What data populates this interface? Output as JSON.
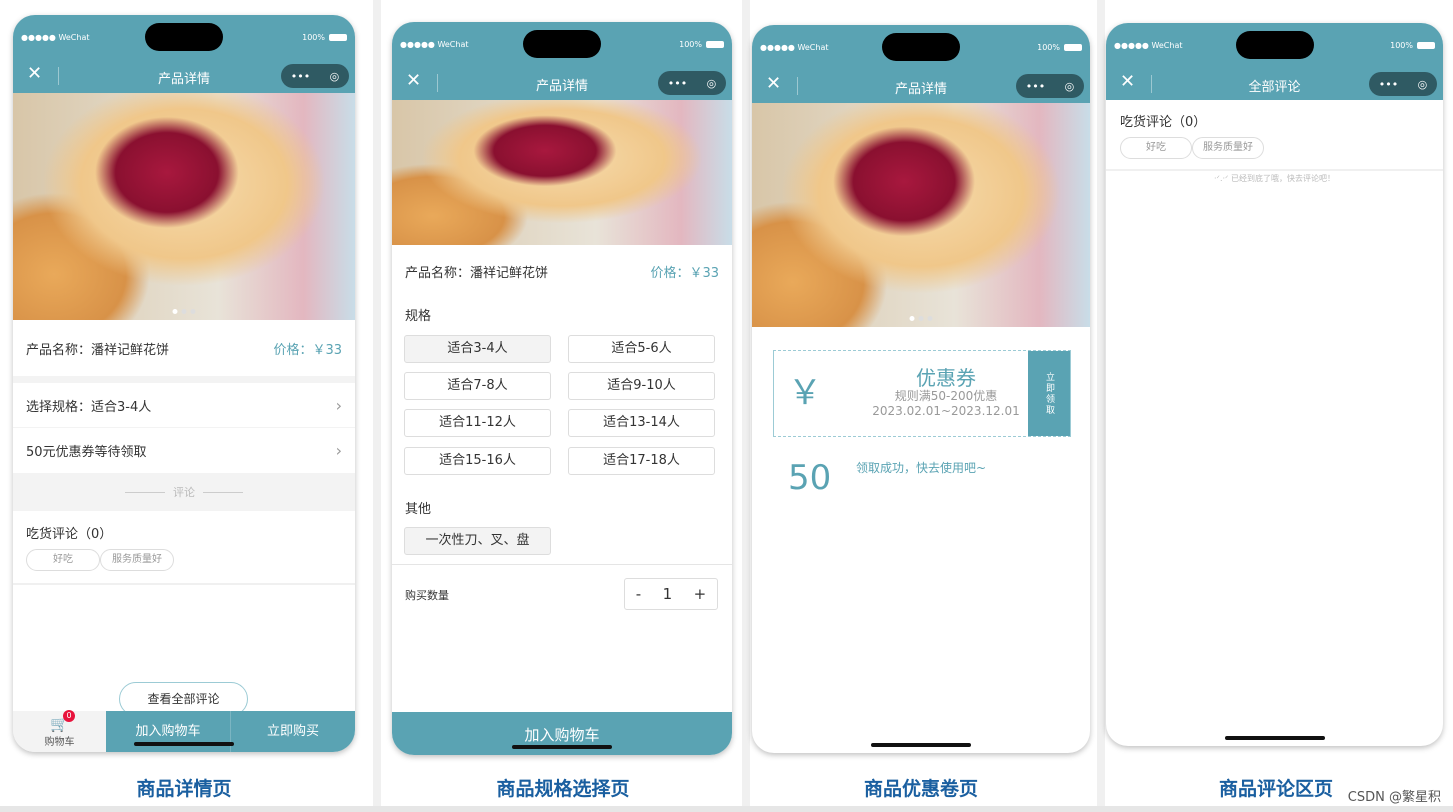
{
  "status": {
    "carrier": "●●●●● WeChat",
    "battery": "100%"
  },
  "colors": {
    "accent": "#5aa3b3",
    "caption": "#1a5fa0",
    "badge": "#e8133c"
  },
  "capsule": {
    "more": "•••",
    "target": "◎"
  },
  "close_icon": "✕",
  "detail": {
    "title": "产品详情",
    "name_label": "产品名称：潘祥记鲜花饼",
    "price": "价格：￥33",
    "spec_row": "选择规格：适合3-4人",
    "coupon_row": "50元优惠券等待领取",
    "chevron": "›",
    "divider": "评论",
    "reviews_title": "吃货评论（0）",
    "tags": [
      "好吃",
      "服务质量好"
    ],
    "view_all": "查看全部评论",
    "cart": "购物车",
    "cart_count": "0",
    "add_cart": "加入购物车",
    "buy_now": "立即购买",
    "caption": "商品详情页"
  },
  "spec": {
    "title": "产品详情",
    "name_label": "产品名称：潘祥记鲜花饼",
    "price": "价格：￥33",
    "spec_heading": "规格",
    "options": [
      "适合3-4人",
      "适合5-6人",
      "适合7-8人",
      "适合9-10人",
      "适合11-12人",
      "适合13-14人",
      "适合15-16人",
      "适合17-18人"
    ],
    "other_heading": "其他",
    "other_option": "一次性刀、叉、盘",
    "qty_label": "购买数量",
    "qty_minus": "-",
    "qty": "1",
    "qty_plus": "+",
    "add_cart": "加入购物车",
    "caption": "商品规格选择页"
  },
  "coupon": {
    "title": "产品详情",
    "amount": "￥ 50",
    "name": "优惠券",
    "rule": "规则满50-200优惠",
    "period": "2023.02.01~2023.12.01",
    "claim": "立即领取",
    "success": "领取成功，快去使用吧~",
    "caption": "商品优惠卷页"
  },
  "reviews": {
    "title": "全部评论",
    "reviews_title": "吃货评论（0）",
    "tags": [
      "好吃",
      "服务质量好"
    ],
    "end_note": "·ᐟ.·ᐟ 已经到底了哦，快去评论吧！",
    "caption": "商品评论区页"
  },
  "watermark": "CSDN @繁星积"
}
